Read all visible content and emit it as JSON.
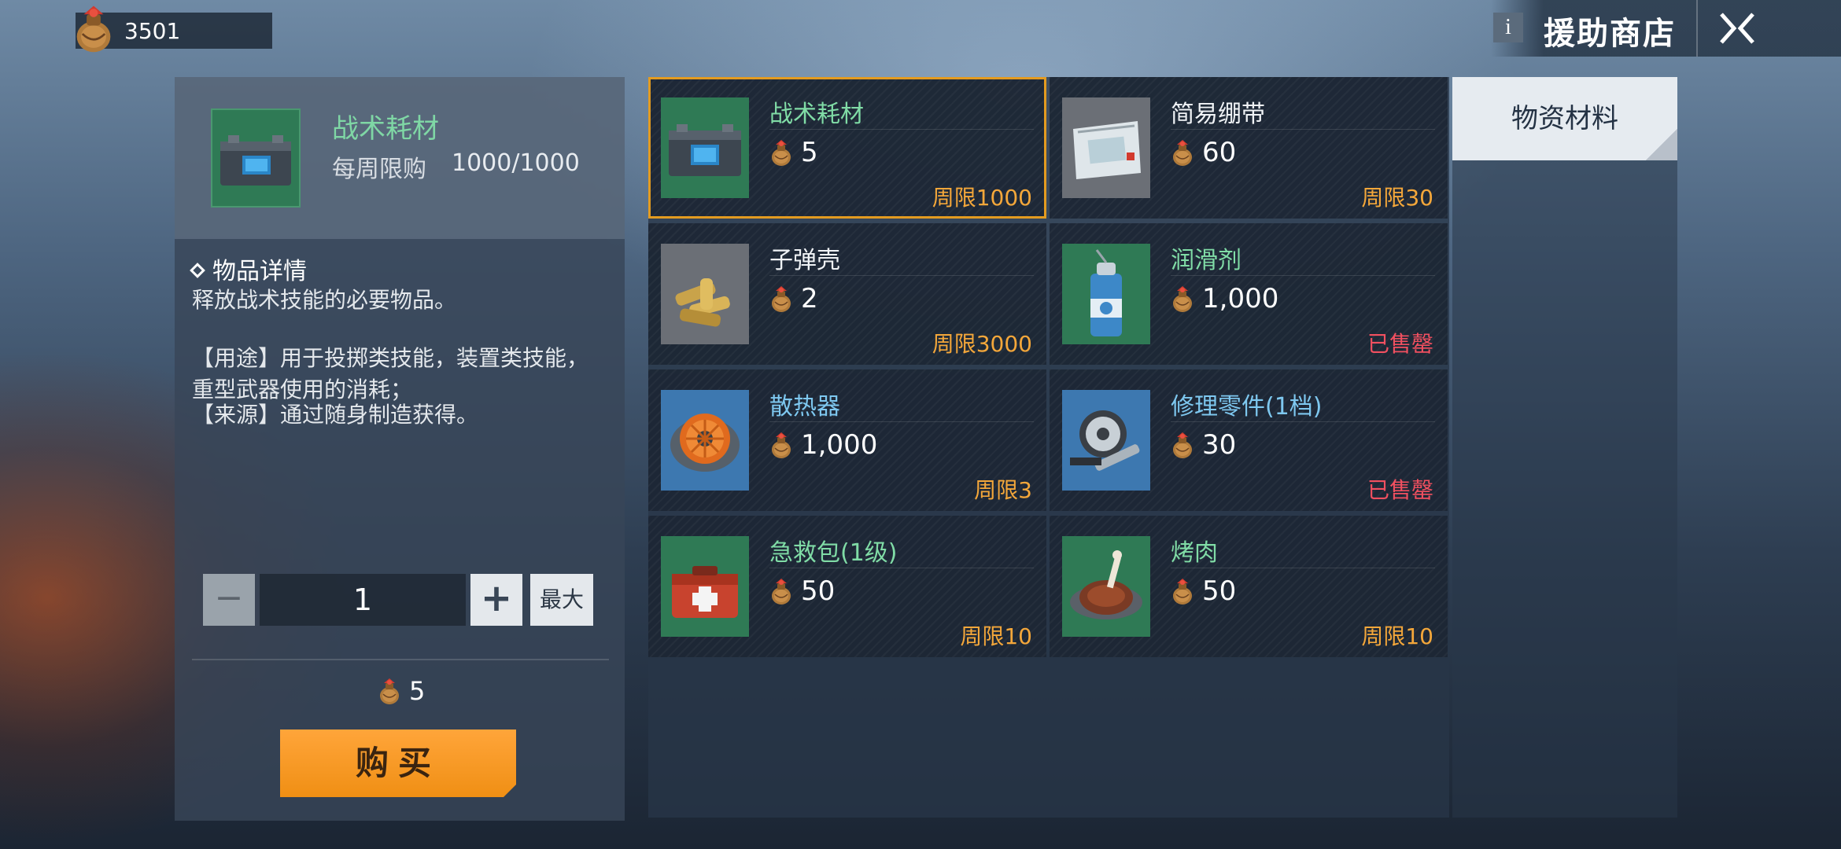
{
  "header": {
    "currency_amount": "3501",
    "info_label": "i",
    "shop_title": "援助商店"
  },
  "detail": {
    "name": "战术耗材",
    "limit_label": "每周限购",
    "limit_value": "1000/1000",
    "section_title": "物品详情",
    "description": "释放战术技能的必要物品。",
    "usage": "【用途】用于投掷类技能，装置类技能，重型武器使用的消耗；",
    "source": "【来源】通过随身制造获得。",
    "quantity": "1",
    "minus_label": "−",
    "plus_label": "+",
    "max_label": "最大",
    "total_price": "5",
    "buy_label": "购买"
  },
  "items": [
    {
      "name": "战术耗材",
      "price": "5",
      "limit": "周限1000",
      "name_color": "green",
      "limit_status": "available",
      "icon": "battery-icon"
    },
    {
      "name": "简易绷带",
      "price": "60",
      "limit": "周限30",
      "name_color": "white",
      "limit_status": "available",
      "icon": "bandage-icon"
    },
    {
      "name": "子弹壳",
      "price": "2",
      "limit": "周限3000",
      "name_color": "white",
      "limit_status": "available",
      "icon": "bullet-casings-icon"
    },
    {
      "name": "润滑剂",
      "price": "1,000",
      "limit": "已售罄",
      "name_color": "green",
      "limit_status": "sold_out",
      "icon": "spray-can-icon"
    },
    {
      "name": "散热器",
      "price": "1,000",
      "limit": "周限3",
      "name_color": "blue",
      "limit_status": "available",
      "icon": "cooling-fan-icon"
    },
    {
      "name": "修理零件(1档)",
      "price": "30",
      "limit": "已售罄",
      "name_color": "blue",
      "limit_status": "sold_out",
      "icon": "repair-parts-icon"
    },
    {
      "name": "急救包(1级)",
      "price": "50",
      "limit": "周限10",
      "name_color": "green",
      "limit_status": "available",
      "icon": "first-aid-kit-icon"
    },
    {
      "name": "烤肉",
      "price": "50",
      "limit": "周限10",
      "name_color": "green",
      "limit_status": "available",
      "icon": "roast-meat-icon"
    }
  ],
  "tabs": [
    {
      "label": "物资材料",
      "active": true
    }
  ],
  "colors": {
    "accent_orange": "#f08f14",
    "selected_border": "#e39b20",
    "limit_orange": "#f4a73a",
    "sold_out_red": "#f25060",
    "name_green": "#80dca6",
    "name_blue": "#7ec8f0"
  }
}
